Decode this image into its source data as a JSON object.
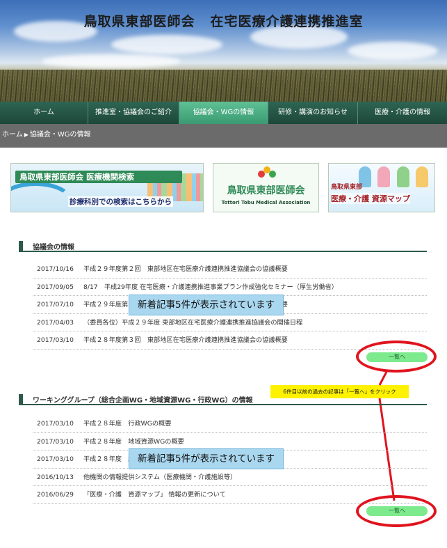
{
  "header": {
    "title_part1": "鳥取県東部医師会",
    "title_part2": "在宅医療介護連携推進室"
  },
  "nav": {
    "items": [
      {
        "label": "ホーム"
      },
      {
        "label": "推進室・協議会のご紹介"
      },
      {
        "label": "協議会・WGの情報",
        "active": true
      },
      {
        "label": "研修・講演のお知らせ"
      },
      {
        "label": "医療・介護の情報"
      }
    ]
  },
  "breadcrumb": {
    "home": "ホーム",
    "current": "協議会・WGの情報"
  },
  "banners": {
    "b1_title": "鳥取県東部医師会 医療機関検索",
    "b1_sub": "診療科別での検索はこちらから",
    "b2_title": "鳥取県東部医師会",
    "b2_sub": "Tottori Tobu Medical Association",
    "b3_line1": "鳥取県東部",
    "b3_line2": "医療・介護 資源マップ"
  },
  "section1": {
    "title": "協議会の情報",
    "items": [
      {
        "date": "2017/10/16",
        "text": "平成２９年度第２回　東部地区在宅医療介護連携推進協議会の協議概要"
      },
      {
        "date": "2017/09/05",
        "text": "8/17　平成29年度 在宅医療・介護連携推進事業プラン作成強化セミナー（厚生労働省）"
      },
      {
        "date": "2017/07/10",
        "text": "平成２９年度第１回　東部地区在宅医療介護連携推進協議会の協議概要"
      },
      {
        "date": "2017/04/03",
        "text": "（委員各位）平成２９年度 東部地区在宅医療介護連携推進協議会の開催日程"
      },
      {
        "date": "2017/03/10",
        "text": "平成２８年度第３回　東部地区在宅医療介護連携推進協議会の協議概要"
      }
    ],
    "more_label": "一覧へ",
    "callout": "新着記事5件が表示されています"
  },
  "section2": {
    "title": "ワーキンググループ（総合企画WG・地域資源WG・行政WG）の情報",
    "items": [
      {
        "date": "2017/03/10",
        "text": "平成２８年度　行政WGの概要"
      },
      {
        "date": "2017/03/10",
        "text": "平成２８年度　地域資源WGの概要"
      },
      {
        "date": "2017/03/10",
        "text": "平成２８年度　総合企画WGの概要"
      },
      {
        "date": "2016/10/13",
        "text": "他機関の情報提供システム（医療機関・介護施設等）"
      },
      {
        "date": "2016/06/29",
        "text": "「医療・介護　資源マップ」 情報の更新について"
      }
    ],
    "more_label": "一覧へ",
    "callout": "新着記事5件が表示されています"
  },
  "annotation": {
    "note": "6件目以前の過去の記事は「一覧へ」をクリック"
  },
  "colors": {
    "nav_bg": "#2e6553",
    "nav_active": "#4fb184",
    "breadcrumb_bg": "#6b6b6b",
    "more_button": "#7eea8e",
    "ring": "#e0141e",
    "callout_bg": "#a9d7ef",
    "note_bg": "#fff200"
  }
}
